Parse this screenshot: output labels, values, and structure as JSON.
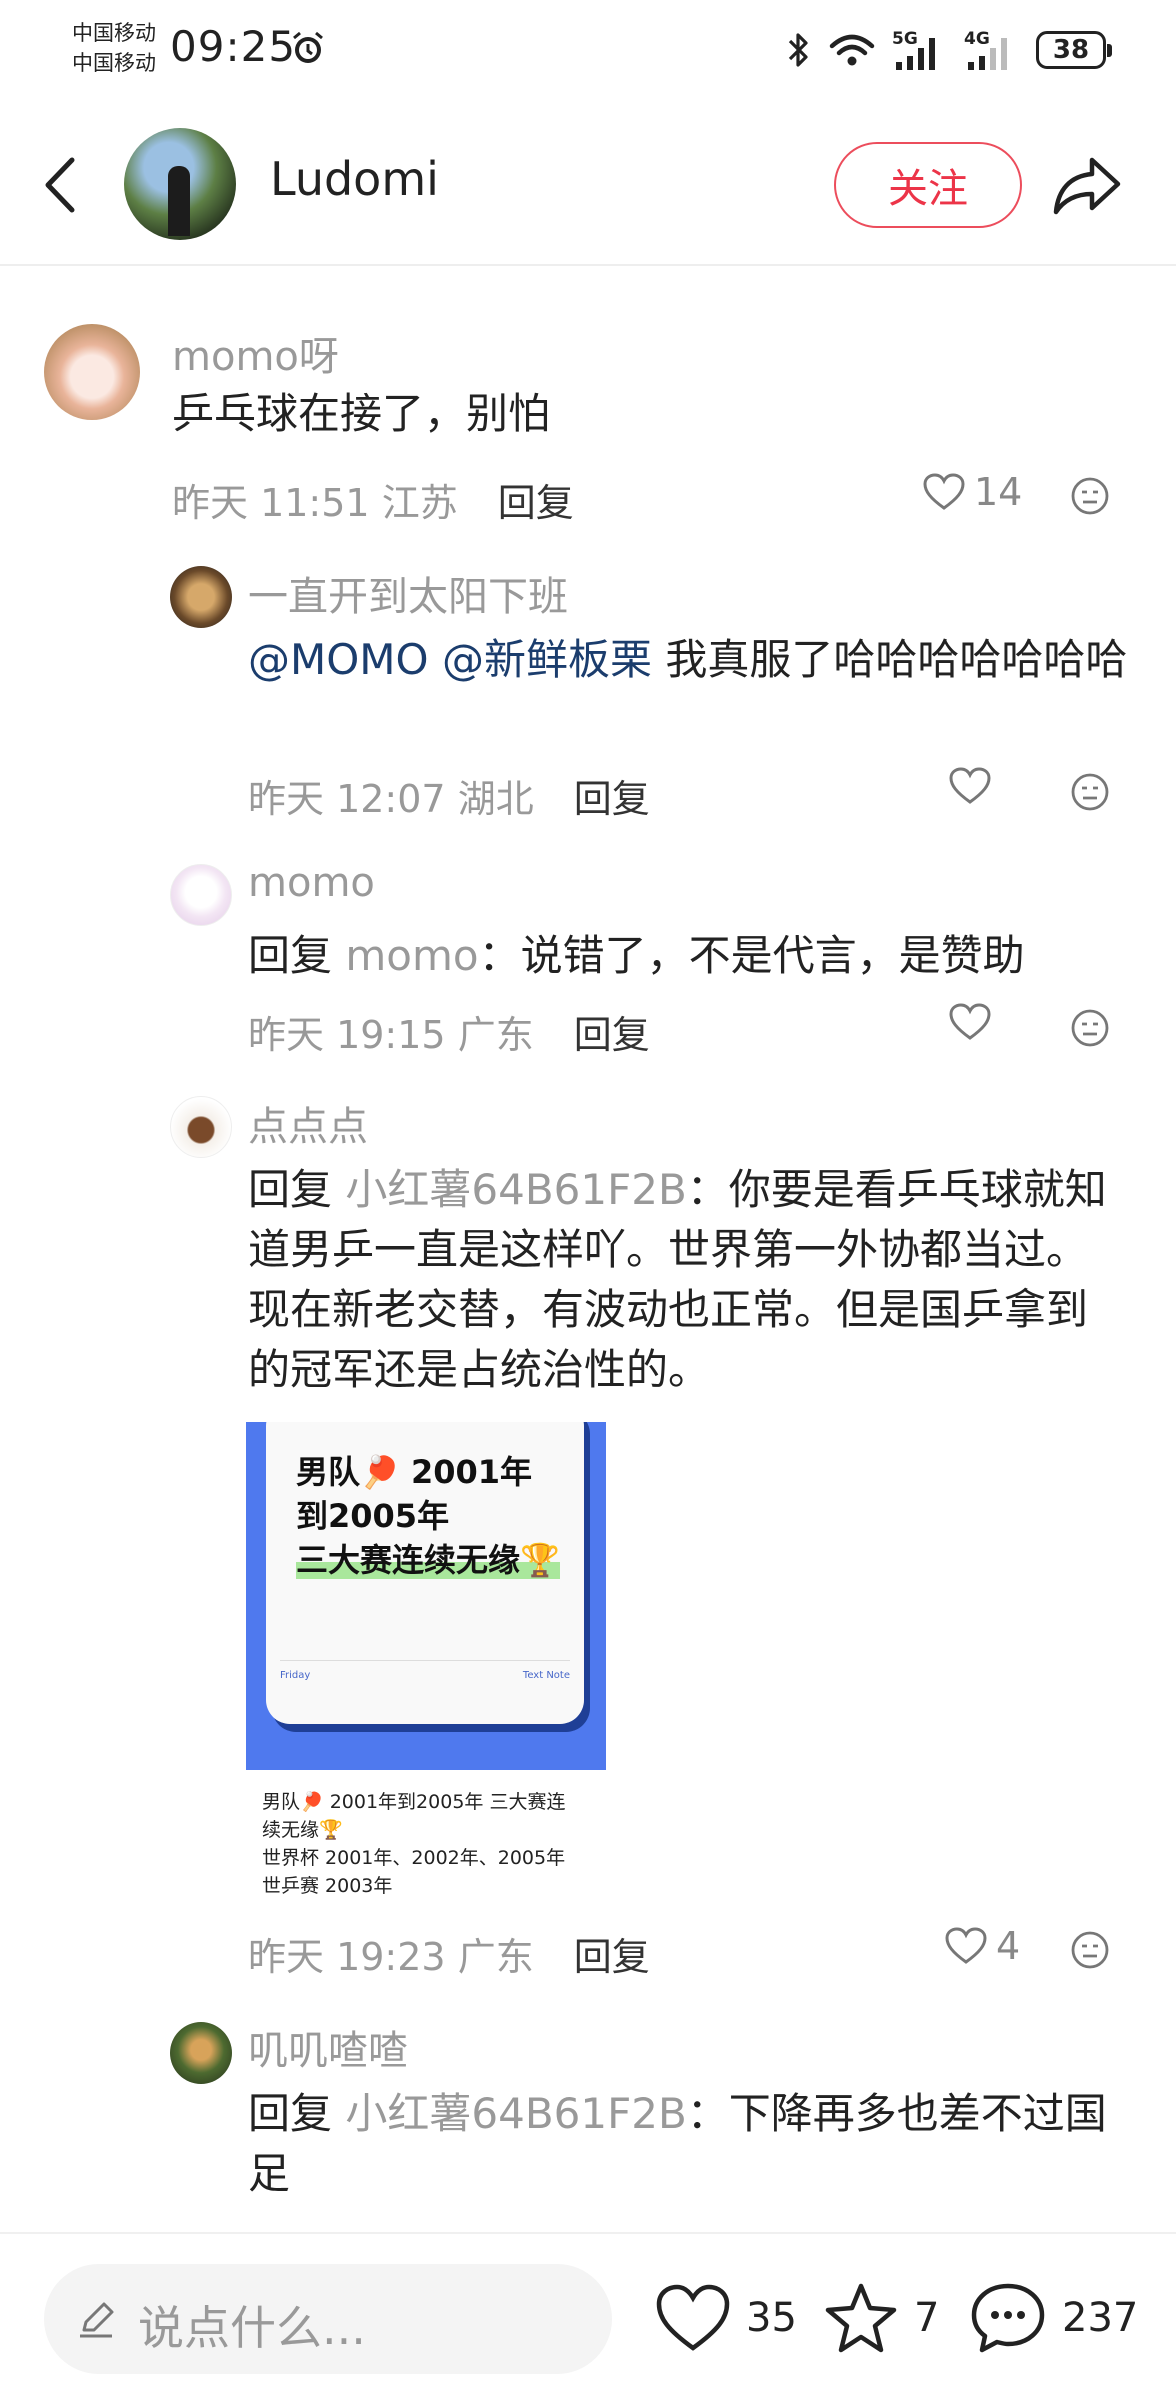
{
  "status_bar": {
    "carrier1": "中国移动",
    "carrier2": "中国移动",
    "time": "09:25",
    "battery": "38",
    "sig1": "5G",
    "sig2": "4G",
    "icons": [
      "alarm-icon",
      "bluetooth-icon",
      "wifi-icon",
      "signal-icon",
      "battery-icon"
    ]
  },
  "header": {
    "name": "Ludomi",
    "follow_label": "关注"
  },
  "comments": [
    {
      "user": "momo呀",
      "text": "乒乓球在接了，别怕",
      "time": "昨天 11:51",
      "location": "江苏",
      "reply_label": "回复",
      "likes": "14"
    },
    {
      "user": "一直开到太阳下班",
      "mentions": [
        "@MOMO",
        "@新鲜板栗"
      ],
      "text": "我真服了哈哈哈哈哈哈哈",
      "time": "昨天 12:07",
      "location": "湖北",
      "reply_label": "回复",
      "likes": ""
    },
    {
      "user": "momo",
      "reply_prefix": "回复",
      "reply_to": "momo",
      "text": "：说错了，不是代言，是赞助",
      "time": "昨天 19:15",
      "location": "广东",
      "reply_label": "回复",
      "likes": ""
    },
    {
      "user": "点点点",
      "reply_prefix": "回复",
      "reply_to": "小红薯64B61F2B",
      "text": "：你要是看乒乓球就知道男乒一直是这样吖。世界第一外协都当过。现在新老交替，有波动也正常。但是国乒拿到的冠军还是占统治性的。",
      "image": {
        "line1": "男队🏓  2001年",
        "line2": "到2005年",
        "line3": "三大赛连续无缘🏆",
        "foot_left": "Friday",
        "foot_right": "Text Note"
      },
      "caption": [
        "男队🏓  2001年到2005年  三大赛连",
        "续无缘🏆",
        "世界杯    2001年、2002年、2005年",
        "世乒赛    2003年"
      ],
      "time": "昨天 19:23",
      "location": "广东",
      "reply_label": "回复",
      "likes": "4"
    },
    {
      "user": "叽叽喳喳",
      "reply_prefix": "回复",
      "reply_to": "小红薯64B61F2B",
      "text": "：下降再多也差不过国足"
    }
  ],
  "bottom_bar": {
    "placeholder": "说点什么...",
    "likes": "35",
    "collects": "7",
    "comments": "237"
  }
}
